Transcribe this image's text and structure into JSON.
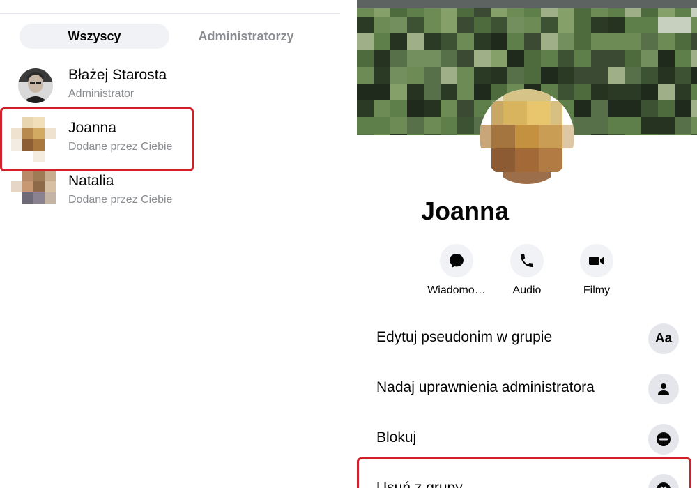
{
  "left_panel": {
    "tabs": [
      {
        "label": "Wszyscy",
        "active": true
      },
      {
        "label": "Administratorzy",
        "active": false
      }
    ],
    "members": [
      {
        "name": "Błażej Starosta",
        "role": "Administrator",
        "avatar": "photo"
      },
      {
        "name": "Joanna",
        "role": "Dodane przez Ciebie",
        "avatar": "pixelated",
        "highlighted": true
      },
      {
        "name": "Natalia",
        "role": "Dodane przez Ciebie",
        "avatar": "pixelated"
      }
    ]
  },
  "profile": {
    "name": "Joanna",
    "actions": [
      {
        "label": "Wiadomo…",
        "icon": "message-bubble-icon"
      },
      {
        "label": "Audio",
        "icon": "phone-icon"
      },
      {
        "label": "Filmy",
        "icon": "video-camera-icon"
      }
    ],
    "options": [
      {
        "label": "Edytuj pseudonim w grupie",
        "icon_text": "Aa",
        "icon": "text-aa-icon"
      },
      {
        "label": "Nadaj uprawnienia administratora",
        "icon": "person-icon"
      },
      {
        "label": "Blokuj",
        "icon": "block-icon"
      },
      {
        "label": "Usuń z grupy",
        "icon": "remove-icon",
        "highlighted": true
      }
    ]
  },
  "colors": {
    "highlight": "#d2202a",
    "tab_bg": "#f0f2f5",
    "muted_text": "#8a8d91",
    "icon_bg": "#e4e6eb"
  }
}
